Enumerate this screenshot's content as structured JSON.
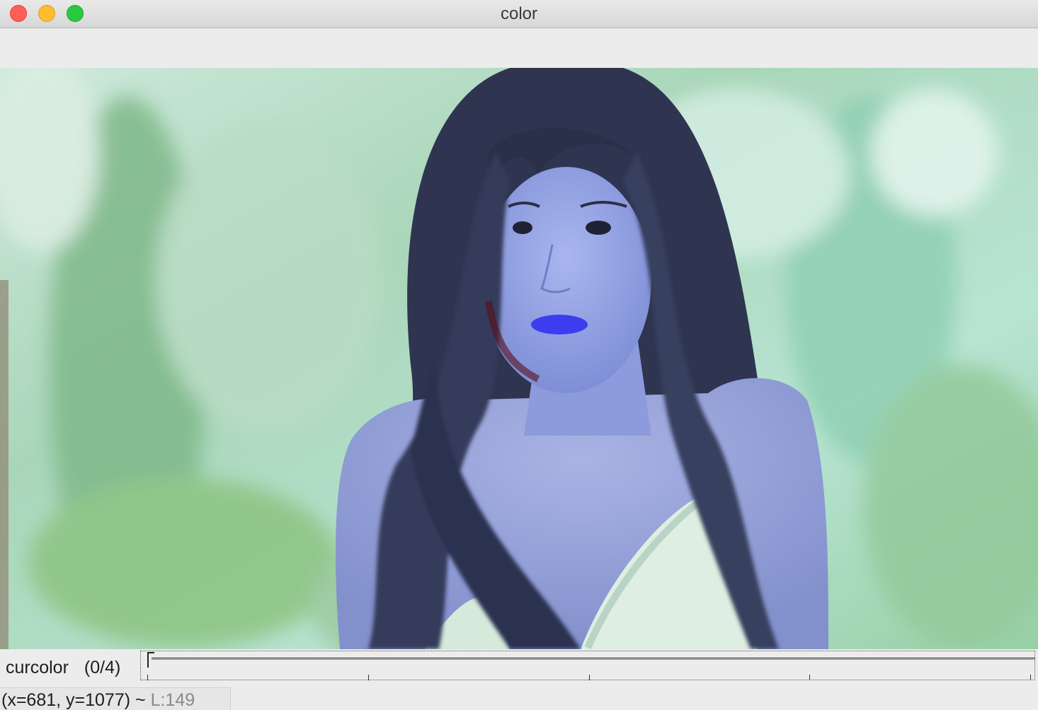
{
  "window": {
    "title": "color"
  },
  "image": {
    "description_icon": "photo-image-icon",
    "tint": "#9aa8e6"
  },
  "trackbar": {
    "name": "curcolor",
    "value_text": "(0/4)",
    "value": 0,
    "max": 4
  },
  "status": {
    "coords": "(x=681, y=1077) ~",
    "luma_label": "L:149"
  },
  "colors": {
    "close": "#fe5f57",
    "minimize": "#febc2e",
    "maximize": "#28c840"
  }
}
